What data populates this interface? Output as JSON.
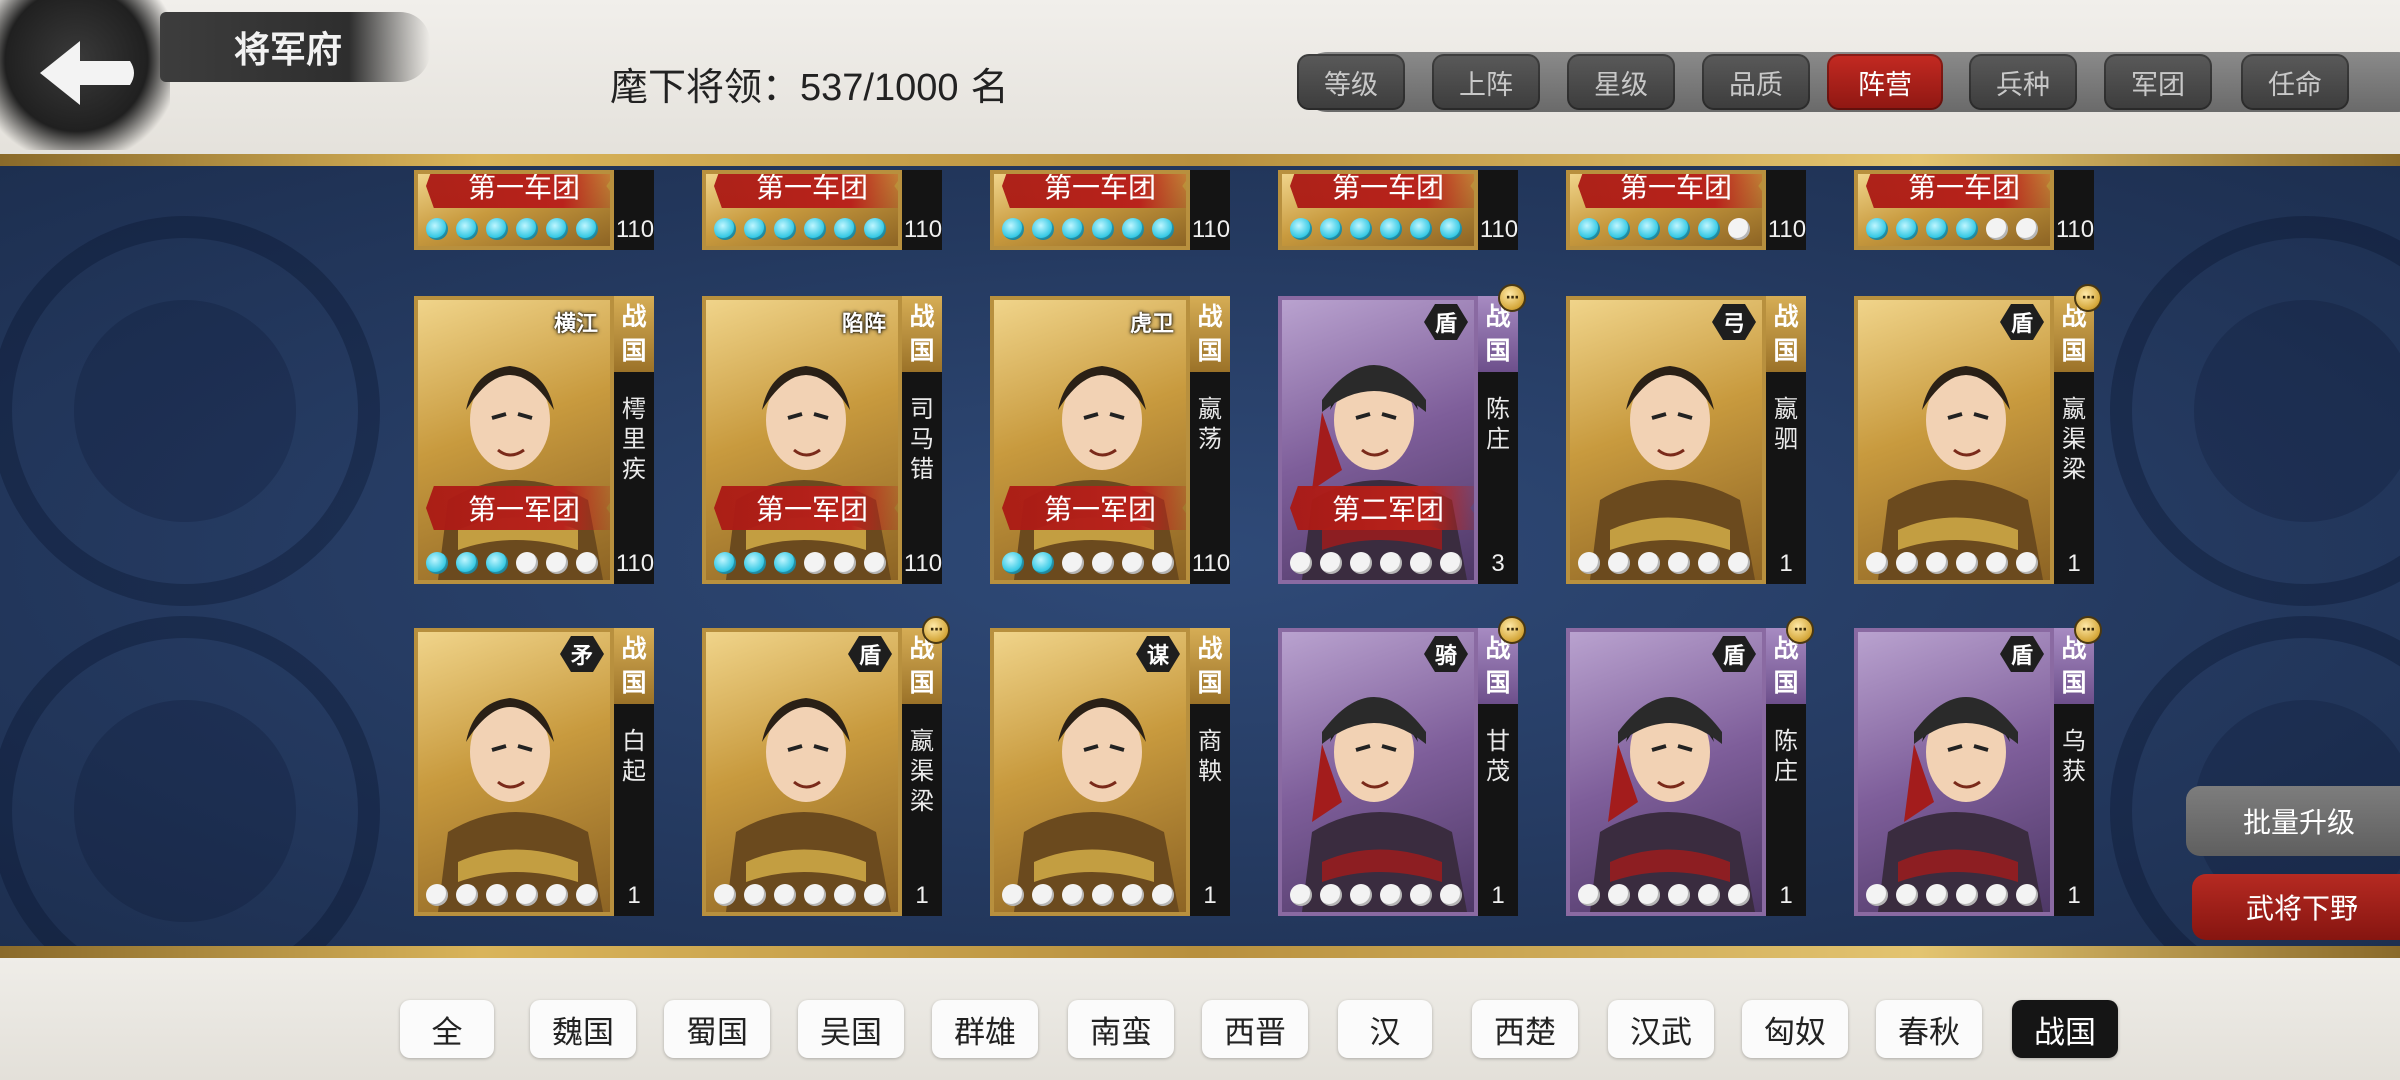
{
  "header": {
    "title": "将军府",
    "count_label": "麾下将领：",
    "count_value": "537/1000",
    "count_unit": "名"
  },
  "sort_tabs": [
    {
      "label": "等级",
      "active": false
    },
    {
      "label": "上阵",
      "active": false
    },
    {
      "label": "星级",
      "active": false
    },
    {
      "label": "品质",
      "active": false
    },
    {
      "label": "阵营",
      "active": true
    },
    {
      "label": "兵种",
      "active": false
    },
    {
      "label": "军团",
      "active": false
    },
    {
      "label": "任命",
      "active": false
    }
  ],
  "row1_partial": [
    {
      "legion": "第一车团",
      "level": "110",
      "stars_lit": 6,
      "color": "gold"
    },
    {
      "legion": "第一车团",
      "level": "110",
      "stars_lit": 6,
      "color": "gold"
    },
    {
      "legion": "第一车团",
      "level": "110",
      "stars_lit": 6,
      "color": "gold"
    },
    {
      "legion": "第一车团",
      "level": "110",
      "stars_lit": 6,
      "color": "gold"
    },
    {
      "legion": "第一车团",
      "level": "110",
      "stars_lit": 5,
      "color": "gold"
    },
    {
      "legion": "第一车团",
      "level": "110",
      "stars_lit": 4,
      "color": "gold"
    }
  ],
  "generals": [
    {
      "name": "樗里疾",
      "faction": "战国",
      "role": "横江",
      "legion": "第一军团",
      "level": "110",
      "stars_lit": 3,
      "color": "gold",
      "more": false
    },
    {
      "name": "司马错",
      "faction": "战国",
      "role": "陷阵",
      "legion": "第一军团",
      "level": "110",
      "stars_lit": 3,
      "color": "gold",
      "more": false
    },
    {
      "name": "嬴荡",
      "faction": "战国",
      "role": "虎卫",
      "legion": "第一军团",
      "level": "110",
      "stars_lit": 2,
      "color": "gold",
      "more": false
    },
    {
      "name": "陈庄",
      "faction": "战国",
      "role": "盾",
      "legion": "第二军团",
      "level": "3",
      "stars_lit": 0,
      "color": "purple",
      "more": true
    },
    {
      "name": "嬴驷",
      "faction": "战国",
      "role": "弓",
      "legion": "",
      "level": "1",
      "stars_lit": 0,
      "color": "gold",
      "more": false
    },
    {
      "name": "嬴渠梁",
      "faction": "战国",
      "role": "盾",
      "legion": "",
      "level": "1",
      "stars_lit": 0,
      "color": "gold",
      "more": true
    },
    {
      "name": "白起",
      "faction": "战国",
      "role": "矛",
      "legion": "",
      "level": "1",
      "stars_lit": 0,
      "color": "gold",
      "more": false
    },
    {
      "name": "嬴渠梁",
      "faction": "战国",
      "role": "盾",
      "legion": "",
      "level": "1",
      "stars_lit": 0,
      "color": "gold",
      "more": true
    },
    {
      "name": "商鞅",
      "faction": "战国",
      "role": "谋",
      "legion": "",
      "level": "1",
      "stars_lit": 0,
      "color": "gold",
      "more": false
    },
    {
      "name": "甘茂",
      "faction": "战国",
      "role": "骑",
      "legion": "",
      "level": "1",
      "stars_lit": 0,
      "color": "purple",
      "more": true
    },
    {
      "name": "陈庄",
      "faction": "战国",
      "role": "盾",
      "legion": "",
      "level": "1",
      "stars_lit": 0,
      "color": "purple",
      "more": true
    },
    {
      "name": "乌获",
      "faction": "战国",
      "role": "盾",
      "legion": "",
      "level": "1",
      "stars_lit": 0,
      "color": "purple",
      "more": true
    }
  ],
  "actions": {
    "batch_upgrade": "批量升级",
    "dismiss": "武将下野"
  },
  "filters": [
    {
      "label": "全",
      "active": false
    },
    {
      "label": "魏国",
      "active": false
    },
    {
      "label": "蜀国",
      "active": false
    },
    {
      "label": "吴国",
      "active": false
    },
    {
      "label": "群雄",
      "active": false
    },
    {
      "label": "南蛮",
      "active": false
    },
    {
      "label": "西晋",
      "active": false
    },
    {
      "label": "汉",
      "active": false
    },
    {
      "label": "西楚",
      "active": false
    },
    {
      "label": "汉武",
      "active": false
    },
    {
      "label": "匈奴",
      "active": false
    },
    {
      "label": "春秋",
      "active": false
    },
    {
      "label": "战国",
      "active": true
    }
  ],
  "colors": {
    "active_tab": "#c42a22",
    "panel_blue": "#24395f",
    "gold_card": "#c89a3e",
    "purple_card": "#7e5e9a",
    "star_lit": "#33c8e4"
  }
}
